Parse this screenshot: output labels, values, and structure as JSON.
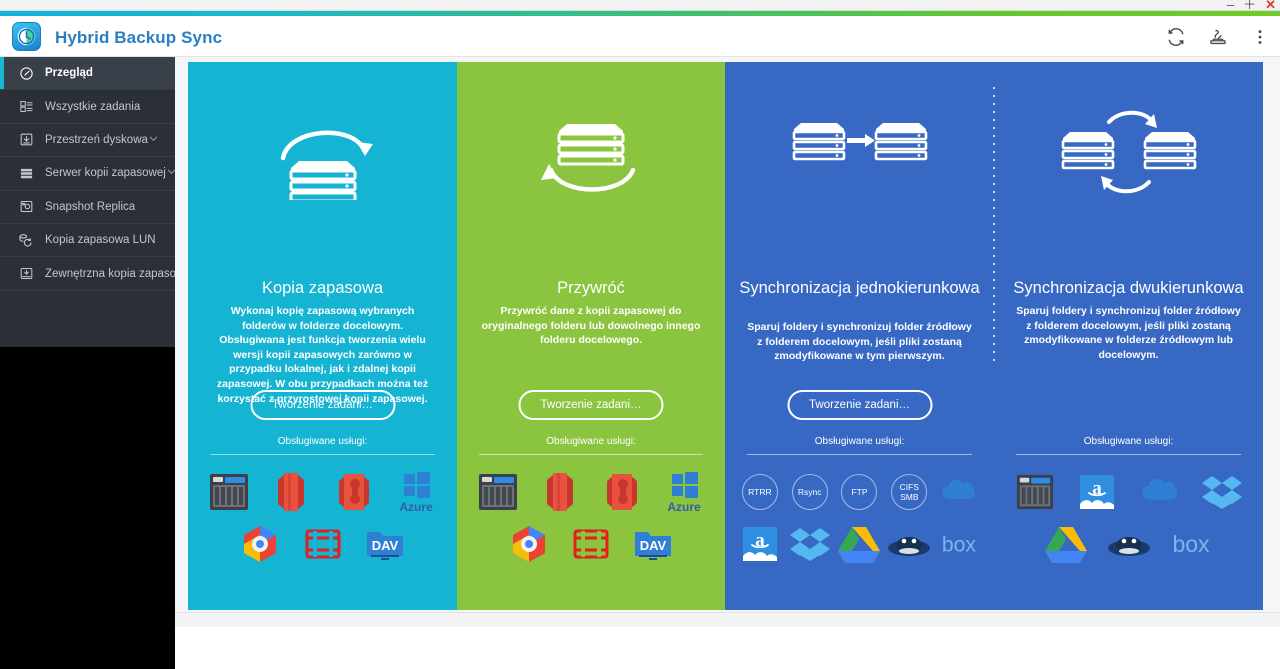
{
  "window": {
    "minimize_label": "–",
    "maximize_label": "＋",
    "close_label": "✕"
  },
  "header": {
    "title": "Hybrid Backup Sync",
    "logo_icon": "hbs-clock-logo-icon",
    "tools": [
      {
        "name": "refresh-icon",
        "label": "Refresh"
      },
      {
        "name": "install-icon",
        "label": "Install"
      },
      {
        "name": "more-options-icon",
        "label": "More"
      }
    ]
  },
  "sidebar": {
    "items": [
      {
        "label": "Przegląd",
        "icon": "dashboard-icon",
        "active": true,
        "expandable": false
      },
      {
        "label": "Wszystkie zadania",
        "icon": "tasks-list-icon",
        "active": false,
        "expandable": false
      },
      {
        "label": "Przestrzeń dyskowa",
        "icon": "storage-download-icon",
        "active": false,
        "expandable": true
      },
      {
        "label": "Serwer kopii zapasowej",
        "icon": "backup-server-icon",
        "active": false,
        "expandable": true
      },
      {
        "label": "Snapshot Replica",
        "icon": "snapshot-camera-icon",
        "active": false,
        "expandable": false
      },
      {
        "label": "Kopia zapasowa LUN",
        "icon": "lun-backup-icon",
        "active": false,
        "expandable": false
      },
      {
        "label": "Zewnętrzna kopia zapasowa",
        "icon": "external-backup-icon",
        "active": false,
        "expandable": false
      }
    ]
  },
  "cards": [
    {
      "id": "backup",
      "title": "Kopia zapasowa",
      "description": "Wykonaj kopię zapasową wybranych folderów w folderze docelowym. Obsługiwana jest funkcja tworzenia wielu wersji kopii zapasowych zarówno w przypadku lokalnej, jak i zdalnej kopii zapasowej. W obu przypadkach można też korzystać z przyrostowej kopii zapasowej.",
      "button_label": "Tworzenie zadani…",
      "services_label": "Obsługiwane usługi:",
      "color": "#16b4d3",
      "art_icon": "nas-backup-arrow-icon",
      "services": [
        {
          "name": "qnap-nas-icon",
          "label": "QNAP NAS"
        },
        {
          "name": "amazon-s3-icon",
          "label": "Amazon S3"
        },
        {
          "name": "amazon-glacier-icon",
          "label": "Amazon Glacier"
        },
        {
          "name": "azure-icon",
          "label": "Azure"
        },
        {
          "name": "google-cloud-storage-icon",
          "label": "Google Cloud Storage"
        },
        {
          "name": "openstack-swift-icon",
          "label": "OpenStack Swift"
        },
        {
          "name": "webdav-icon",
          "label": "WebDAV"
        }
      ]
    },
    {
      "id": "restore",
      "title": "Przywróć",
      "description": "Przywróć dane z kopii zapasowej do oryginalnego folderu lub dowolnego innego folderu docelowego.",
      "button_label": "Tworzenie zadani…",
      "services_label": "Obsługiwane usługi:",
      "color": "#8bc53f",
      "art_icon": "nas-restore-arrow-icon",
      "services": [
        {
          "name": "qnap-nas-icon",
          "label": "QNAP NAS"
        },
        {
          "name": "amazon-s3-icon",
          "label": "Amazon S3"
        },
        {
          "name": "amazon-glacier-icon",
          "label": "Amazon Glacier"
        },
        {
          "name": "azure-icon",
          "label": "Azure"
        },
        {
          "name": "google-cloud-storage-icon",
          "label": "Google Cloud Storage"
        },
        {
          "name": "openstack-swift-icon",
          "label": "OpenStack Swift"
        },
        {
          "name": "webdav-icon",
          "label": "WebDAV"
        }
      ]
    },
    {
      "id": "one-way-sync",
      "title": "Synchronizacja jednokierunkowa",
      "description": "Sparuj foldery i synchronizuj folder źródłowy z folderem docelowym, jeśli pliki zostaną zmodyfikowane w tym pierwszym.",
      "button_label": "Tworzenie zadani…",
      "services_label": "Obsługiwane usługi:",
      "color": "#3768c4",
      "art_icon": "nas-one-way-arrow-icon",
      "services": [
        {
          "name": "rtrr-protocol-icon",
          "label": "RTRR",
          "type": "circle"
        },
        {
          "name": "rsync-protocol-icon",
          "label": "Rsync",
          "type": "circle"
        },
        {
          "name": "ftp-protocol-icon",
          "label": "FTP",
          "type": "circle"
        },
        {
          "name": "cifs-smb-protocol-icon",
          "label": "CIFS SMB",
          "type": "circle"
        },
        {
          "name": "onedrive-icon",
          "label": "OneDrive"
        },
        {
          "name": "amazon-drive-icon",
          "label": "Amazon Drive"
        },
        {
          "name": "dropbox-icon",
          "label": "Dropbox"
        },
        {
          "name": "google-drive-icon",
          "label": "Google Drive"
        },
        {
          "name": "yandex-disk-icon",
          "label": "Yandex Disk"
        },
        {
          "name": "box-icon",
          "label": "box"
        }
      ]
    },
    {
      "id": "two-way-sync",
      "title": "Synchronizacja dwukierunkowa",
      "description": "Sparuj foldery i synchronizuj folder źródłowy z folderem docelowym, jeśli pliki zostaną zmodyfikowane w folderze źródłowym lub docelowym.",
      "button_label": null,
      "services_label": "Obsługiwane usługi:",
      "color": "#3768c4",
      "art_icon": "nas-two-way-arrow-icon",
      "services": [
        {
          "name": "qnap-nas-icon",
          "label": "QNAP NAS"
        },
        {
          "name": "amazon-drive-icon",
          "label": "Amazon Drive"
        },
        {
          "name": "onedrive-icon",
          "label": "OneDrive"
        },
        {
          "name": "dropbox-icon",
          "label": "Dropbox"
        },
        {
          "name": "google-drive-icon",
          "label": "Google Drive"
        },
        {
          "name": "yandex-disk-icon",
          "label": "Yandex Disk"
        },
        {
          "name": "box-icon",
          "label": "box"
        }
      ]
    }
  ],
  "colors": {
    "accent_cyan": "#16b4d3",
    "accent_green": "#8bc53f",
    "accent_blue": "#3768c4",
    "sidebar_bg": "#2b3038",
    "title_blue": "#2a7fc4"
  }
}
